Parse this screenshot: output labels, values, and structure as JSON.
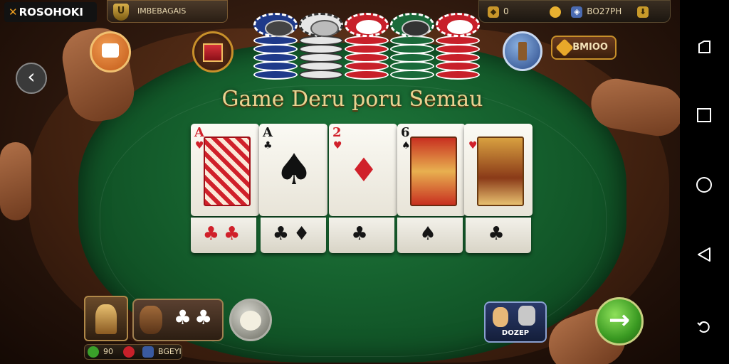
{
  "top_bar": {
    "logo_text": "ROSOHOKI",
    "level_badge": "U",
    "level_label": "IMBEBAGAIS",
    "gems_value": "0",
    "coins_value": "",
    "currency_label": "BO27PH",
    "shop_icon": "download-icon"
  },
  "table": {
    "title": "Game Deru poru Semau",
    "felt_color": "#135a2a"
  },
  "cards": [
    {
      "rank": "A",
      "suit": "♥",
      "color": "red",
      "art": "red-pattern"
    },
    {
      "rank": "A",
      "suit": "♣",
      "color": "black",
      "art": "black-flourish"
    },
    {
      "rank": "2",
      "suit": "♥",
      "color": "red",
      "art": "red-diamonds"
    },
    {
      "rank": "6",
      "suit": "♠",
      "color": "black",
      "art": "jack-portrait"
    },
    {
      "rank": "",
      "suit": "♥",
      "color": "red",
      "art": "king-portrait"
    }
  ],
  "lower_cards": [
    {
      "glyphs": "♣♣",
      "color": "red"
    },
    {
      "glyphs": "♣♦",
      "color": "black"
    },
    {
      "glyphs": "♣",
      "color": "black"
    },
    {
      "glyphs": "♠",
      "color": "black"
    },
    {
      "glyphs": "♣",
      "color": "black"
    }
  ],
  "buttons": {
    "chip_pack_label": "BMIOO",
    "next_symbol": "→",
    "doze_label": "DOZEP"
  },
  "player": {
    "hand_suits": "♣♣",
    "bottom_value_1": "90",
    "bottom_value_2": "BGEYI"
  },
  "chip_stacks": [
    {
      "color": "#1f3a8a",
      "trim": "#ffffff"
    },
    {
      "color": "#e6e6e6",
      "trim": "#333333"
    },
    {
      "color": "#c8202a",
      "trim": "#ffffff"
    },
    {
      "color": "#1a6a3a",
      "trim": "#ffffff"
    },
    {
      "color": "#c8202a",
      "trim": "#ffffff"
    }
  ]
}
